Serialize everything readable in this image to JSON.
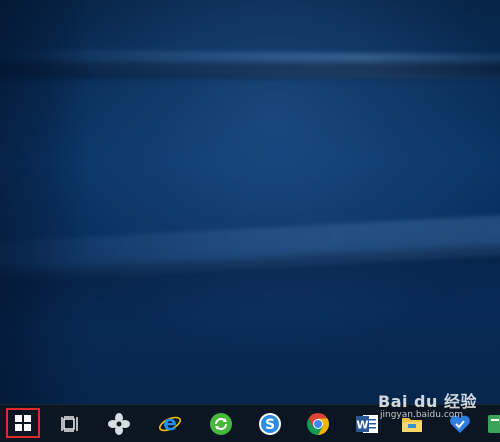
{
  "watermark": {
    "brand": "Bai du 经验",
    "url": "jingyan.baidu.com"
  },
  "taskbar": {
    "items": [
      {
        "icon": "windows-start-icon",
        "highlight_color": "#e02a2a"
      },
      {
        "icon": "task-view-icon"
      },
      {
        "icon": "pinwheel-app-icon"
      },
      {
        "icon": "internet-explorer-icon",
        "color": "#1e90ff"
      },
      {
        "icon": "green-refresh-app-icon",
        "color": "#46b83c"
      },
      {
        "icon": "sogou-browser-icon",
        "color": "#2b8ce6"
      },
      {
        "icon": "chrome-icon"
      },
      {
        "icon": "word-icon",
        "color": "#2b5797"
      },
      {
        "icon": "file-explorer-icon",
        "color": "#f4c542"
      },
      {
        "icon": "blue-heart-app-icon",
        "color": "#2f7de1"
      },
      {
        "icon": "green-app-icon",
        "color": "#3aa35a"
      }
    ]
  }
}
